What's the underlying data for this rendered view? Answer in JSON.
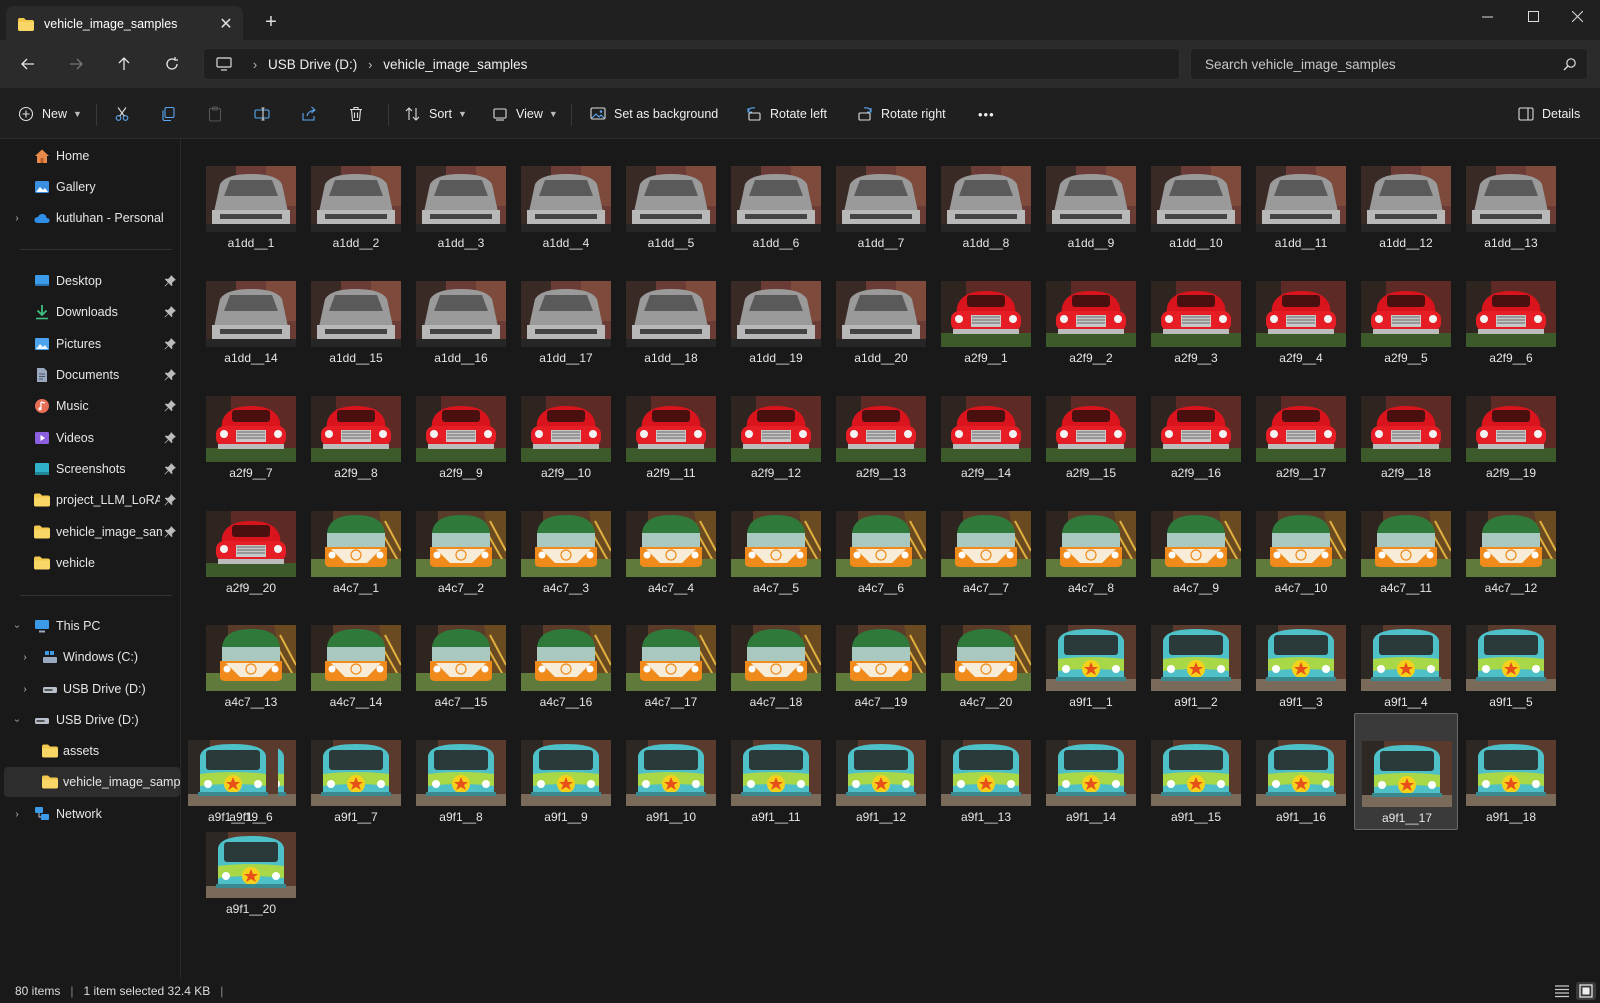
{
  "window": {
    "tab_title": "vehicle_image_samples",
    "new_tab": "+",
    "controls": {
      "minimize": "—",
      "maximize": "☐",
      "close": "✕"
    }
  },
  "address": {
    "crumbs": [
      "USB Drive (D:)",
      "vehicle_image_samples"
    ],
    "search_placeholder": "Search vehicle_image_samples"
  },
  "commands": {
    "new": "New",
    "sort": "Sort",
    "view": "View",
    "set_background": "Set as background",
    "rotate_left": "Rotate left",
    "rotate_right": "Rotate right",
    "more": "•••",
    "details": "Details"
  },
  "sidebar": {
    "top": [
      {
        "label": "Home",
        "icon": "home-icon"
      },
      {
        "label": "Gallery",
        "icon": "gallery-icon"
      },
      {
        "label": "kutluhan - Personal",
        "icon": "cloud-icon"
      }
    ],
    "pinned": [
      {
        "label": "Desktop",
        "icon": "desktop-icon",
        "color": "#3c9be8"
      },
      {
        "label": "Downloads",
        "icon": "download-icon",
        "color": "#3fbf7f"
      },
      {
        "label": "Pictures",
        "icon": "pictures-icon",
        "color": "#4ba3f0"
      },
      {
        "label": "Documents",
        "icon": "documents-icon",
        "color": "#9aa9c0"
      },
      {
        "label": "Music",
        "icon": "music-icon",
        "color": "#e66e55"
      },
      {
        "label": "Videos",
        "icon": "videos-icon",
        "color": "#8b5fe0"
      },
      {
        "label": "Screenshots",
        "icon": "screenshots-icon",
        "color": "#2fb2c9"
      },
      {
        "label": "project_LLM_LoRA",
        "icon": "folder-icon",
        "color": "#f2c94c"
      },
      {
        "label": "vehicle_image_samp",
        "icon": "folder-icon",
        "color": "#f2c94c"
      },
      {
        "label": "vehicle",
        "icon": "folder-icon",
        "color": "#f2c94c"
      }
    ],
    "tree": [
      {
        "label": "This PC",
        "icon": "pc-icon",
        "expanded": true
      },
      {
        "label": "Windows (C:)",
        "icon": "drive-icon",
        "expanded": false
      },
      {
        "label": "USB Drive (D:)",
        "icon": "usb-drive-icon",
        "expanded": false
      },
      {
        "label": "USB Drive (D:)",
        "icon": "usb-drive-icon",
        "expanded": true
      },
      {
        "label": "assets",
        "icon": "folder-icon"
      },
      {
        "label": "vehicle_image_sample",
        "icon": "folder-icon",
        "selected": true
      },
      {
        "label": "Network",
        "icon": "network-icon",
        "expanded": false
      }
    ]
  },
  "files": [
    {
      "name": "a1dd__1",
      "kind": "silver"
    },
    {
      "name": "a1dd__2",
      "kind": "silver"
    },
    {
      "name": "a1dd__3",
      "kind": "silver"
    },
    {
      "name": "a1dd__4",
      "kind": "silver"
    },
    {
      "name": "a1dd__5",
      "kind": "silver"
    },
    {
      "name": "a1dd__6",
      "kind": "silver"
    },
    {
      "name": "a1dd__7",
      "kind": "silver"
    },
    {
      "name": "a1dd__8",
      "kind": "silver"
    },
    {
      "name": "a1dd__9",
      "kind": "silver"
    },
    {
      "name": "a1dd__10",
      "kind": "silver"
    },
    {
      "name": "a1dd__11",
      "kind": "silver"
    },
    {
      "name": "a1dd__12",
      "kind": "silver"
    },
    {
      "name": "a1dd__13",
      "kind": "silver"
    },
    {
      "name": "a1dd__14",
      "kind": "silver"
    },
    {
      "name": "a1dd__15",
      "kind": "silver"
    },
    {
      "name": "a1dd__16",
      "kind": "silver"
    },
    {
      "name": "a1dd__17",
      "kind": "silver"
    },
    {
      "name": "a1dd__18",
      "kind": "silver"
    },
    {
      "name": "a1dd__19",
      "kind": "silver"
    },
    {
      "name": "a1dd__20",
      "kind": "silver"
    },
    {
      "name": "a2f9__1",
      "kind": "red"
    },
    {
      "name": "a2f9__2",
      "kind": "red"
    },
    {
      "name": "a2f9__3",
      "kind": "red"
    },
    {
      "name": "a2f9__4",
      "kind": "red"
    },
    {
      "name": "a2f9__5",
      "kind": "red"
    },
    {
      "name": "a2f9__6",
      "kind": "red"
    },
    {
      "name": "a2f9__7",
      "kind": "red"
    },
    {
      "name": "a2f9__8",
      "kind": "red"
    },
    {
      "name": "a2f9__9",
      "kind": "red"
    },
    {
      "name": "a2f9__10",
      "kind": "red"
    },
    {
      "name": "a2f9__11",
      "kind": "red"
    },
    {
      "name": "a2f9__12",
      "kind": "red"
    },
    {
      "name": "a2f9__13",
      "kind": "red"
    },
    {
      "name": "a2f9__14",
      "kind": "red"
    },
    {
      "name": "a2f9__15",
      "kind": "red"
    },
    {
      "name": "a2f9__16",
      "kind": "red"
    },
    {
      "name": "a2f9__17",
      "kind": "red"
    },
    {
      "name": "a2f9__18",
      "kind": "red"
    },
    {
      "name": "a2f9__19",
      "kind": "red"
    },
    {
      "name": "a2f9__20",
      "kind": "red"
    },
    {
      "name": "a4c7__1",
      "kind": "vw"
    },
    {
      "name": "a4c7__2",
      "kind": "vw"
    },
    {
      "name": "a4c7__3",
      "kind": "vw"
    },
    {
      "name": "a4c7__4",
      "kind": "vw"
    },
    {
      "name": "a4c7__5",
      "kind": "vw"
    },
    {
      "name": "a4c7__6",
      "kind": "vw"
    },
    {
      "name": "a4c7__7",
      "kind": "vw"
    },
    {
      "name": "a4c7__8",
      "kind": "vw"
    },
    {
      "name": "a4c7__9",
      "kind": "vw"
    },
    {
      "name": "a4c7__10",
      "kind": "vw"
    },
    {
      "name": "a4c7__11",
      "kind": "vw"
    },
    {
      "name": "a4c7__12",
      "kind": "vw"
    },
    {
      "name": "a4c7__13",
      "kind": "vw"
    },
    {
      "name": "a4c7__14",
      "kind": "vw"
    },
    {
      "name": "a4c7__15",
      "kind": "vw"
    },
    {
      "name": "a4c7__16",
      "kind": "vw"
    },
    {
      "name": "a4c7__17",
      "kind": "vw"
    },
    {
      "name": "a4c7__18",
      "kind": "vw"
    },
    {
      "name": "a4c7__19",
      "kind": "vw"
    },
    {
      "name": "a4c7__20",
      "kind": "vw"
    },
    {
      "name": "a9f1__1",
      "kind": "mystery"
    },
    {
      "name": "a9f1__2",
      "kind": "mystery"
    },
    {
      "name": "a9f1__3",
      "kind": "mystery"
    },
    {
      "name": "a9f1__4",
      "kind": "mystery"
    },
    {
      "name": "a9f1__5",
      "kind": "mystery"
    },
    {
      "name": "a9f1__6",
      "kind": "mystery"
    },
    {
      "name": "a9f1__7",
      "kind": "mystery"
    },
    {
      "name": "a9f1__8",
      "kind": "mystery"
    },
    {
      "name": "a9f1__9",
      "kind": "mystery"
    },
    {
      "name": "a9f1__10",
      "kind": "mystery"
    },
    {
      "name": "a9f1__11",
      "kind": "mystery"
    },
    {
      "name": "a9f1__12",
      "kind": "mystery"
    },
    {
      "name": "a9f1__13",
      "kind": "mystery"
    },
    {
      "name": "a9f1__14",
      "kind": "mystery"
    },
    {
      "name": "a9f1__15",
      "kind": "mystery"
    },
    {
      "name": "a9f1__16",
      "kind": "mystery"
    },
    {
      "name": "a9f1__17",
      "kind": "mystery",
      "selected": true
    },
    {
      "name": "a9f1__18",
      "kind": "mystery"
    },
    {
      "name": "a9f1__19",
      "kind": "mystery"
    },
    {
      "name": "a9f1__20",
      "kind": "mystery"
    }
  ],
  "status": {
    "count": "80 items",
    "selection": "1 item selected  32.4 KB"
  },
  "colors": {
    "folder": "#f2c94c",
    "accent": "#4ba3f0"
  }
}
